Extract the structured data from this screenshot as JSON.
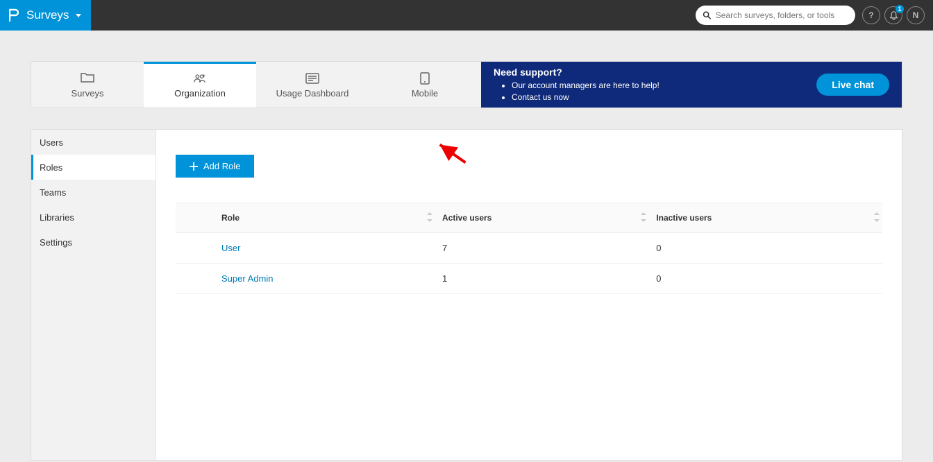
{
  "header": {
    "brand_label": "Surveys",
    "search_placeholder": "Search surveys, folders, or tools",
    "help_label": "?",
    "notif_count": "1",
    "avatar_initial": "N"
  },
  "nav_tabs": [
    {
      "label": "Surveys",
      "active": false,
      "icon": "folder"
    },
    {
      "label": "Organization",
      "active": true,
      "icon": "people"
    },
    {
      "label": "Usage Dashboard",
      "active": false,
      "icon": "article"
    },
    {
      "label": "Mobile",
      "active": false,
      "icon": "phone"
    }
  ],
  "support": {
    "title": "Need support?",
    "lines": [
      "Our account managers are here to help!",
      "Contact us now"
    ],
    "live_chat": "Live chat"
  },
  "side_nav": [
    {
      "label": "Users",
      "active": false
    },
    {
      "label": "Roles",
      "active": true
    },
    {
      "label": "Teams",
      "active": false
    },
    {
      "label": "Libraries",
      "active": false
    },
    {
      "label": "Settings",
      "active": false
    }
  ],
  "add_button": "Add Role",
  "table": {
    "headers": [
      "Role",
      "Active users",
      "Inactive users"
    ],
    "rows": [
      {
        "role": "User",
        "active": "7",
        "inactive": "0"
      },
      {
        "role": "Super Admin",
        "active": "1",
        "inactive": "0"
      }
    ]
  }
}
